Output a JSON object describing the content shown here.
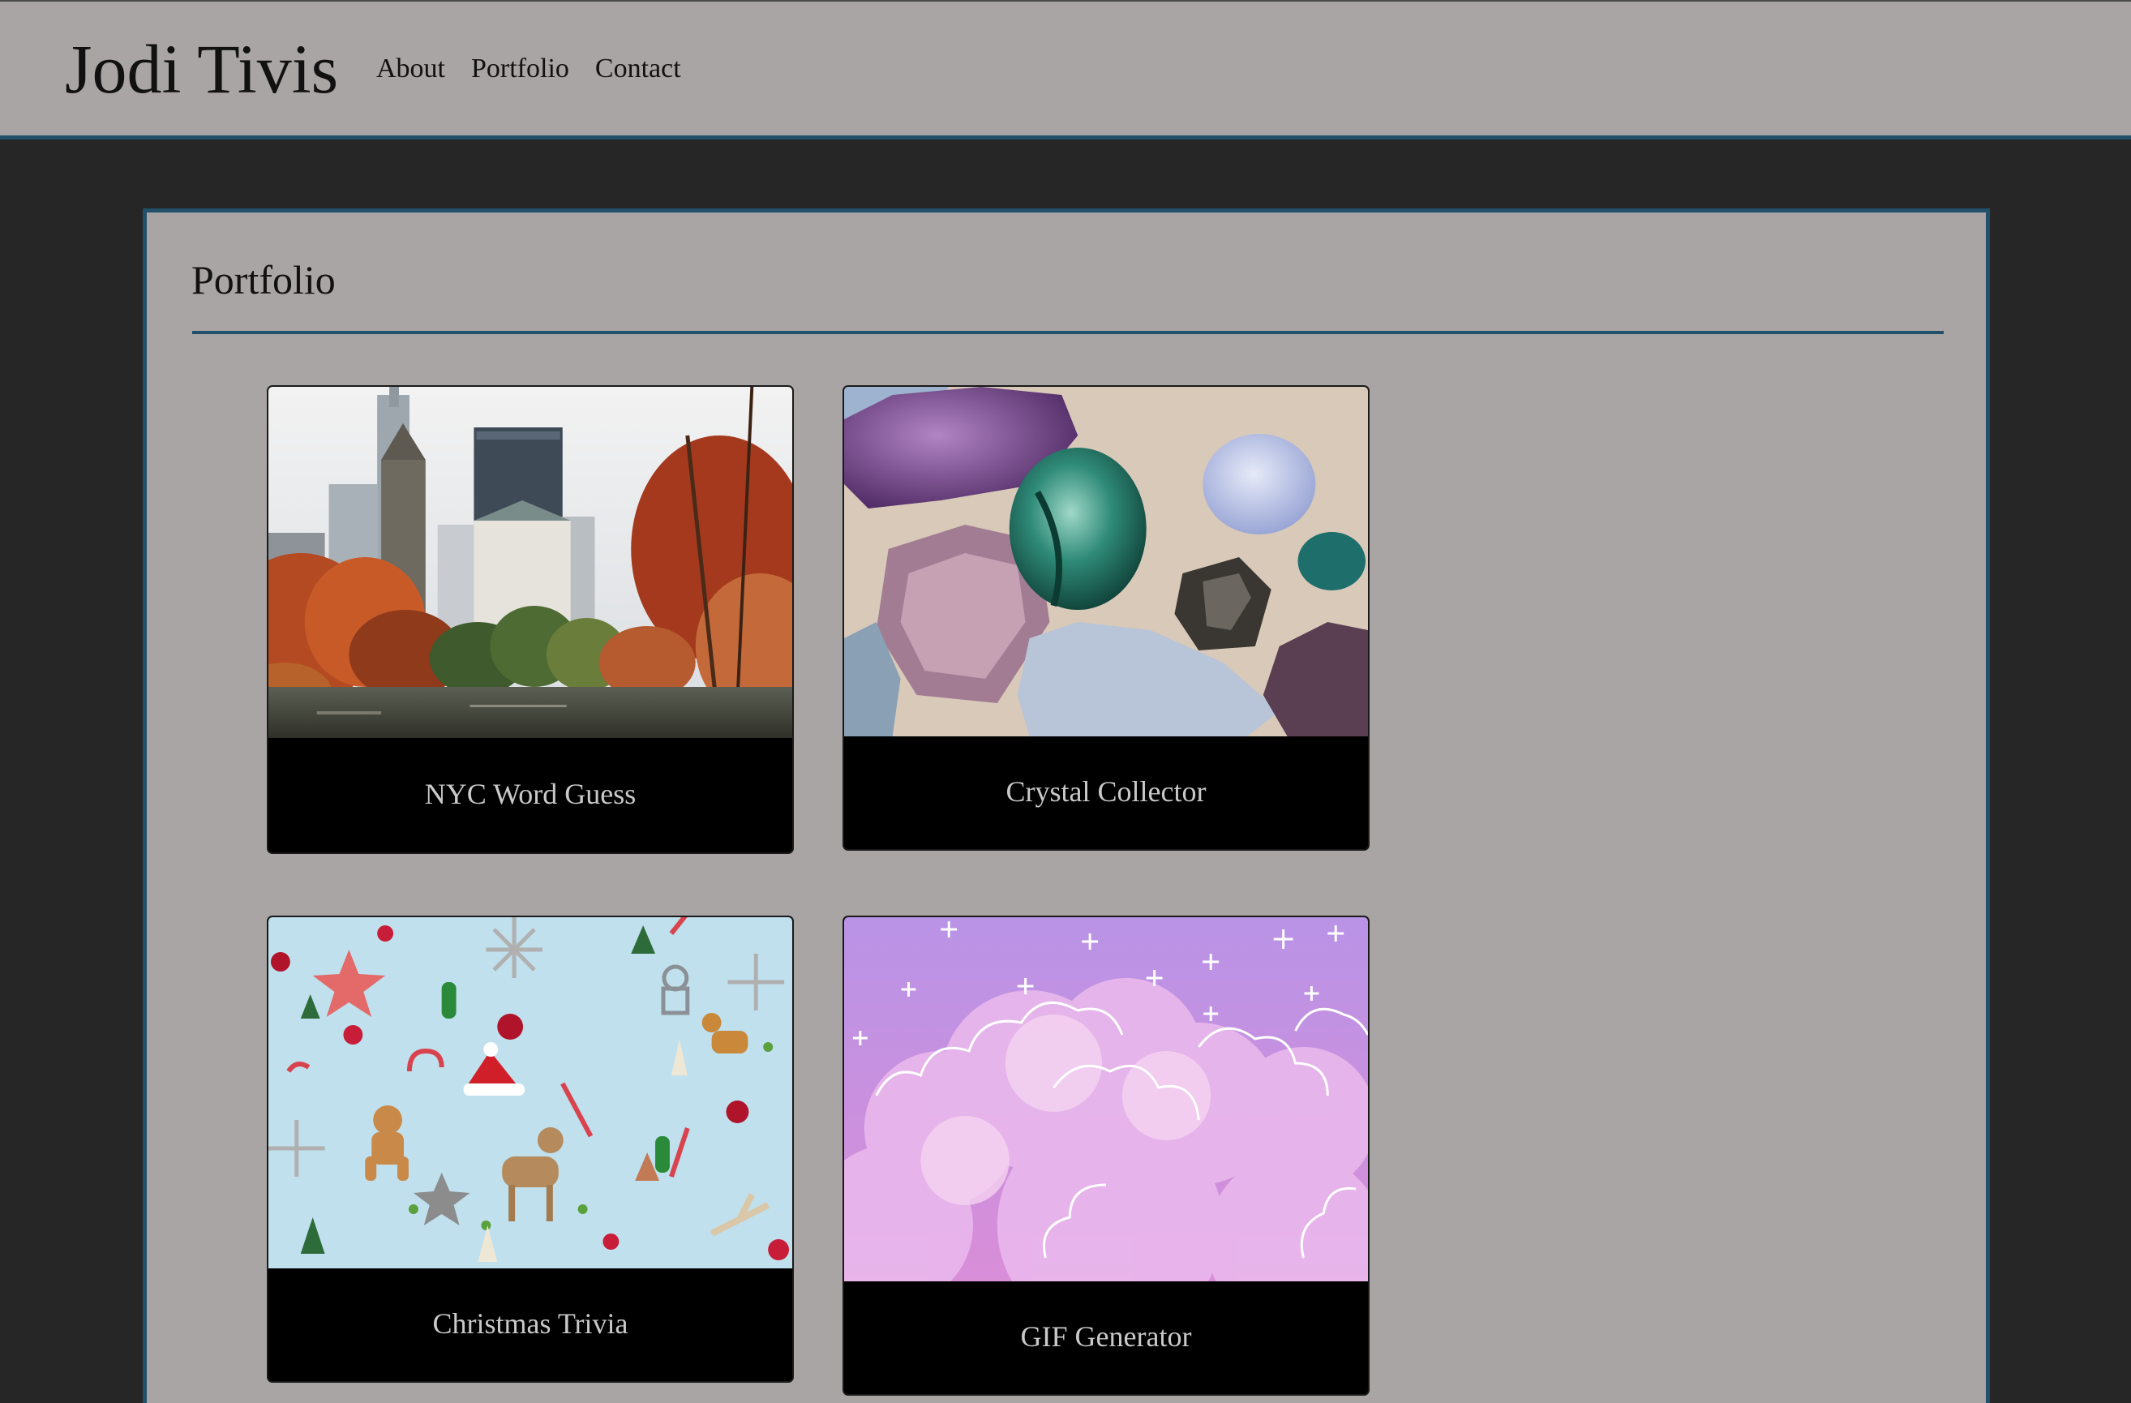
{
  "header": {
    "title": "Jodi Tivis",
    "nav": [
      {
        "label": "About"
      },
      {
        "label": "Portfolio"
      },
      {
        "label": "Contact"
      }
    ]
  },
  "main": {
    "heading": "Portfolio",
    "projects": [
      {
        "title": "NYC Word Guess",
        "image_alt": "Central Park in autumn with Manhattan skyline"
      },
      {
        "title": "Crystal Collector",
        "image_alt": "Assorted crystals and gemstones"
      },
      {
        "title": "Christmas Trivia",
        "image_alt": "Christmas ornaments on light blue background"
      },
      {
        "title": "GIF Generator",
        "image_alt": "Pink and purple clouds with sparkles"
      }
    ]
  },
  "colors": {
    "page_background": "#262626",
    "surface": "#aaa5a5",
    "accent": "#21506a",
    "card_background": "#000000",
    "card_text": "#c9c9c9"
  }
}
